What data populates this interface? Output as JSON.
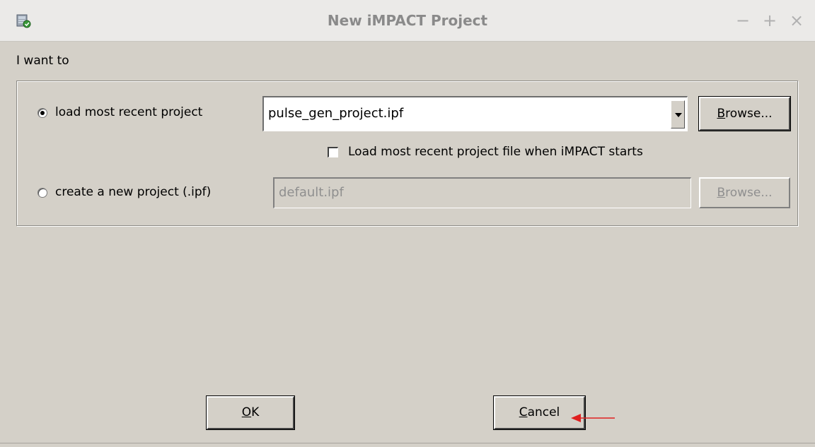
{
  "window": {
    "title": "New iMPACT Project",
    "controls": {
      "minimize": "−",
      "maximize": "+",
      "close": "×"
    }
  },
  "prompt": "I want to",
  "options": {
    "load_recent": {
      "label": "load most recent project",
      "selected": true,
      "combo_value": "pulse_gen_project.ipf",
      "browse": {
        "mnemonic": "B",
        "rest": "rowse..."
      }
    },
    "autoload": {
      "label": "Load most recent project file when iMPACT starts",
      "checked": false
    },
    "create_new": {
      "label": "create a new project (.ipf)",
      "selected": false,
      "field_value": "default.ipf",
      "browse": {
        "mnemonic": "B",
        "rest": "rowse..."
      }
    }
  },
  "buttons": {
    "ok": {
      "mnemonic": "O",
      "rest": "K"
    },
    "cancel": {
      "mnemonic": "C",
      "rest": "ancel"
    }
  },
  "colors": {
    "dialog_bg": "#d4d0c8",
    "titlebar_bg": "#ebeae8",
    "annotation_arrow": "#e02020"
  },
  "icons": {
    "app": "impact-app-icon",
    "annotation": "red-arrow-icon"
  }
}
